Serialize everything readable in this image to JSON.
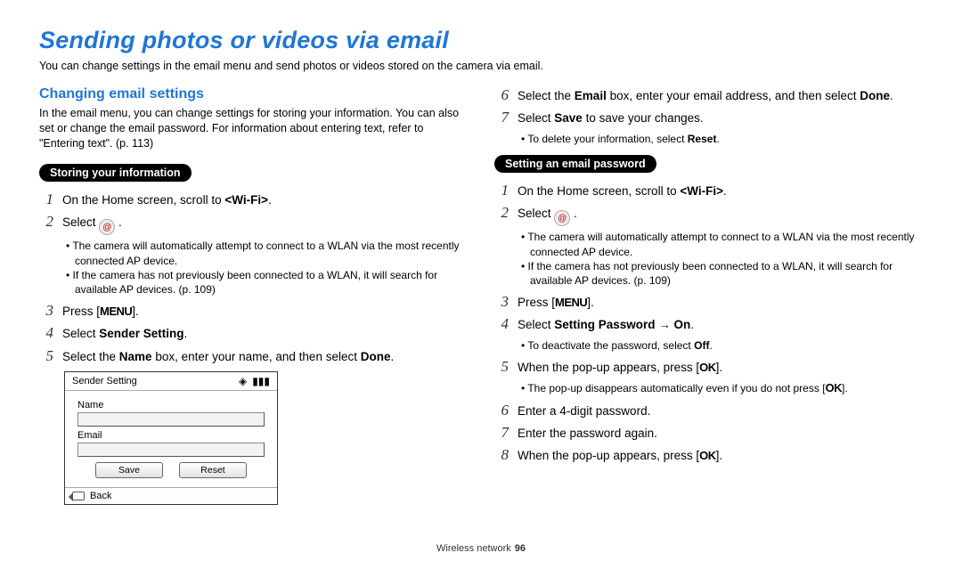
{
  "title": "Sending photos or videos via email",
  "intro": "You can change settings in the email menu and send photos or videos stored on the camera via email.",
  "section_heading": "Changing email settings",
  "section_body": "In the email menu, you can change settings for storing your information. You can also set or change the email password. For information about entering text, refer to \"Entering text\". (p. 113)",
  "glyphs": {
    "menu": "MENU",
    "ok": "OK"
  },
  "left": {
    "pill": "Storing your information",
    "steps": {
      "s1": {
        "num": "1",
        "pre": "On the Home screen, scroll to ",
        "bold": "<Wi-Fi>",
        "post": "."
      },
      "s2": {
        "num": "2",
        "pre": "Select ",
        "post": " .",
        "sub1": "The camera will automatically attempt to connect to a WLAN via the most recently connected AP device.",
        "sub2": "If the camera has not previously been connected to a WLAN, it will search for available AP devices. (p. 109)"
      },
      "s3": {
        "num": "3",
        "pre": "Press [",
        "post": "]."
      },
      "s4": {
        "num": "4",
        "pre": "Select ",
        "bold": "Sender Setting",
        "post": "."
      },
      "s5": {
        "num": "5",
        "pre": "Select the ",
        "bold1": "Name",
        "mid": " box, enter your name, and then select ",
        "bold2": "Done",
        "post": "."
      }
    },
    "device": {
      "title": "Sender Setting",
      "name_label": "Name",
      "email_label": "Email",
      "save_btn": "Save",
      "reset_btn": "Reset",
      "back_label": "Back"
    }
  },
  "right_top": {
    "s6": {
      "num": "6",
      "pre": "Select the ",
      "bold1": "Email",
      "mid": " box, enter your email address, and then select ",
      "bold2": "Done",
      "post": "."
    },
    "s7": {
      "num": "7",
      "pre": "Select ",
      "bold": "Save",
      "post": " to save your changes.",
      "sub1_pre": "To delete your information, select ",
      "sub1_bold": "Reset",
      "sub1_post": "."
    }
  },
  "right": {
    "pill": "Setting an email password",
    "steps": {
      "s1": {
        "num": "1",
        "pre": "On the Home screen, scroll to ",
        "bold": "<Wi-Fi>",
        "post": "."
      },
      "s2": {
        "num": "2",
        "pre": "Select ",
        "post": " .",
        "sub1": "The camera will automatically attempt to connect to a WLAN via the most recently connected AP device.",
        "sub2": "If the camera has not previously been connected to a WLAN, it will search for available AP devices. (p. 109)"
      },
      "s3": {
        "num": "3",
        "pre": "Press [",
        "post": "]."
      },
      "s4": {
        "num": "4",
        "pre": "Select ",
        "bold": "Setting Password → On",
        "post": ".",
        "sub1_pre": "To deactivate the password, select ",
        "sub1_bold": "Off",
        "sub1_post": "."
      },
      "s5": {
        "num": "5",
        "pre": "When the pop-up appears, press [",
        "post": "].",
        "sub1_pre": "The pop-up disappears automatically even if you do not press [",
        "sub1_post": "]."
      },
      "s6": {
        "num": "6",
        "text": "Enter a 4-digit password."
      },
      "s7": {
        "num": "7",
        "text": "Enter the password again."
      },
      "s8": {
        "num": "8",
        "pre": "When the pop-up appears, press [",
        "post": "]."
      }
    }
  },
  "footer": {
    "label": "Wireless network",
    "page": "96"
  }
}
